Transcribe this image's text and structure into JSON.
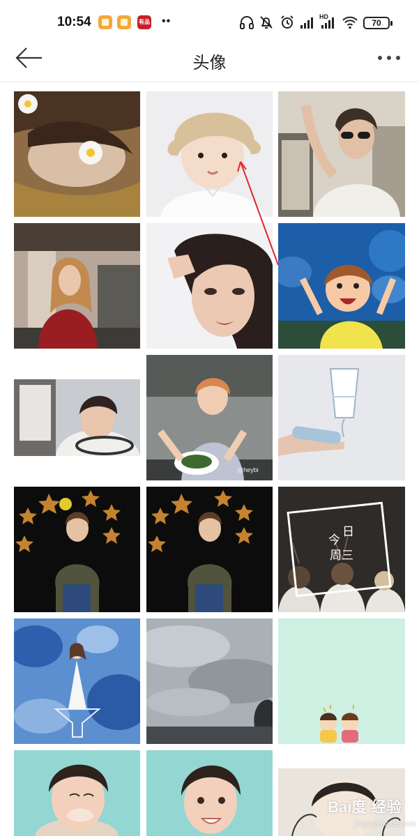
{
  "status_bar": {
    "time": "10:54",
    "badge_3_text": "有品",
    "more": "••",
    "network_label": "HD",
    "battery": "70"
  },
  "header": {
    "title": "头像"
  },
  "grid": {
    "columns": 3,
    "tile_captions": {
      "glass_text": "今日\n周三",
      "line_1": "今",
      "line_2": "日",
      "line_3": "周三"
    },
    "stamp": "@heybi"
  },
  "watermark": {
    "brand": "Bai度 经验",
    "url": "jingyan.baidu.com"
  },
  "colors": {
    "accent_red": "#e3262b",
    "header_text": "#222222",
    "separator": "#ececec"
  }
}
